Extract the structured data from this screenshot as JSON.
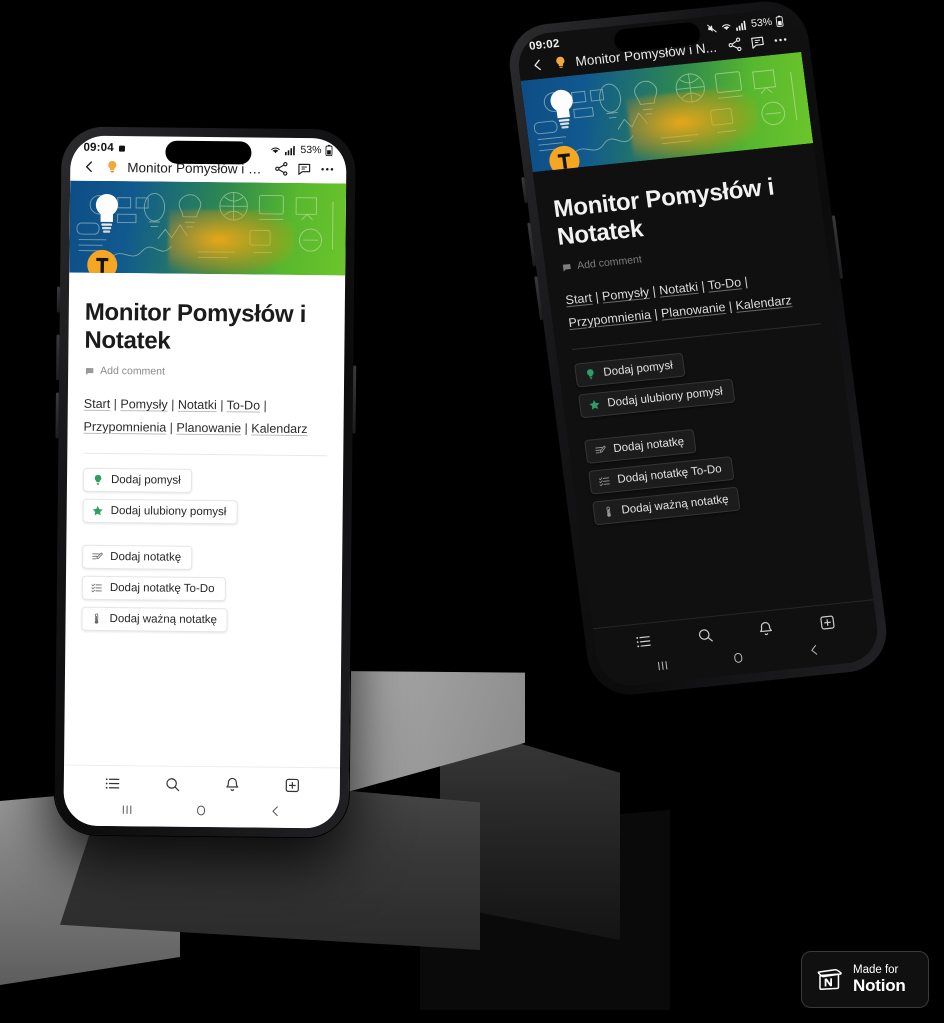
{
  "scene": {
    "background_color": "#000000",
    "pedestal_color": "#9e9e9e"
  },
  "badge": {
    "made_for": "Made for",
    "notion": "Notion",
    "logo_icon": "notion-logo-icon"
  },
  "phones": [
    {
      "id": "front",
      "theme": "light",
      "status": {
        "time": "09:04",
        "battery": "53%",
        "wifi_icon": "wifi-icon",
        "signal_icon": "signal-bars-icon",
        "battery_icon": "battery-icon",
        "alarm_icon": "alarm-icon"
      },
      "topbar": {
        "back_icon": "chevron-left-icon",
        "page_emoji": "lightbulb-icon",
        "title": "Monitor Pomysłów i N...",
        "share_icon": "share-icon",
        "comment_icon": "comment-icon",
        "more_icon": "more-horizontal-icon"
      },
      "page": {
        "title": "Monitor Pomysłów i Notatek",
        "add_comment": "Add comment",
        "add_comment_icon": "comment-icon",
        "links": [
          "Start",
          "Pomysły",
          "Notatki",
          "To-Do",
          "Przypomnienia",
          "Planowanie",
          "Kalendarz"
        ],
        "separator": "|"
      },
      "buttons_primary": [
        {
          "label": "Dodaj pomysł",
          "icon": "lightbulb-icon",
          "color": "#2e9e63"
        },
        {
          "label": "Dodaj ulubiony pomysł",
          "icon": "star-icon",
          "color": "#2e9e63"
        }
      ],
      "buttons_secondary": [
        {
          "label": "Dodaj notatkę",
          "icon": "note-edit-icon",
          "color": "#6b6b6b"
        },
        {
          "label": "Dodaj notatkę To-Do",
          "icon": "checklist-icon",
          "color": "#6b6b6b"
        },
        {
          "label": "Dodaj ważną notatkę",
          "icon": "thermometer-icon",
          "color": "#6b6b6b"
        }
      ],
      "navbar": [
        {
          "icon": "list-icon",
          "name": "nav-home"
        },
        {
          "icon": "search-icon",
          "name": "nav-search"
        },
        {
          "icon": "bell-icon",
          "name": "nav-inbox"
        },
        {
          "icon": "plus-box-icon",
          "name": "nav-new-page"
        }
      ],
      "sysnav": [
        {
          "icon": "recents-icon",
          "name": "android-recents"
        },
        {
          "icon": "home-circle-icon",
          "name": "android-home"
        },
        {
          "icon": "back-chevron-icon",
          "name": "android-back"
        }
      ]
    },
    {
      "id": "back",
      "theme": "dark",
      "status": {
        "time": "09:02",
        "battery": "53%",
        "wifi_icon": "wifi-icon",
        "signal_icon": "signal-bars-icon",
        "battery_icon": "battery-icon",
        "alarm_icon": "mute-icon"
      },
      "topbar": {
        "back_icon": "chevron-left-icon",
        "page_emoji": "lightbulb-icon",
        "title": "Monitor Pomysłów i N...",
        "share_icon": "share-icon",
        "comment_icon": "comment-icon",
        "more_icon": "more-horizontal-icon"
      },
      "page": {
        "title": "Monitor Pomysłów i Notatek",
        "add_comment": "Add comment",
        "add_comment_icon": "comment-icon",
        "links": [
          "Start",
          "Pomysły",
          "Notatki",
          "To-Do",
          "Przypomnienia",
          "Planowanie",
          "Kalendarz"
        ],
        "separator": "|"
      },
      "buttons_primary": [
        {
          "label": "Dodaj pomysł",
          "icon": "lightbulb-icon",
          "color": "#2e9e63"
        },
        {
          "label": "Dodaj ulubiony pomysł",
          "icon": "star-icon",
          "color": "#2e9e63"
        }
      ],
      "buttons_secondary": [
        {
          "label": "Dodaj notatkę",
          "icon": "note-edit-icon",
          "color": "#9a9a9a"
        },
        {
          "label": "Dodaj notatkę To-Do",
          "icon": "checklist-icon",
          "color": "#9a9a9a"
        },
        {
          "label": "Dodaj ważną notatkę",
          "icon": "thermometer-icon",
          "color": "#9a9a9a"
        }
      ],
      "navbar": [
        {
          "icon": "list-icon",
          "name": "nav-home"
        },
        {
          "icon": "search-icon",
          "name": "nav-search"
        },
        {
          "icon": "bell-icon",
          "name": "nav-inbox"
        },
        {
          "icon": "plus-box-icon",
          "name": "nav-new-page"
        }
      ],
      "sysnav": [
        {
          "icon": "recents-icon",
          "name": "android-recents"
        },
        {
          "icon": "home-circle-icon",
          "name": "android-home"
        },
        {
          "icon": "back-chevron-icon",
          "name": "android-back"
        }
      ]
    }
  ]
}
